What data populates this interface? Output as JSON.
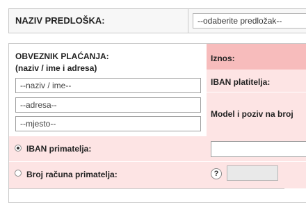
{
  "template": {
    "label": "NAZIV PREDLOŠKA:",
    "select_value": "--odaberite predložak--"
  },
  "payer": {
    "heading": "OBVEZNIK PLAĆANJA:",
    "subheading": "(naziv / ime i adresa)",
    "name_placeholder": "--naziv / ime--",
    "address_placeholder": "--adresa--",
    "city_placeholder": "--mjesto--"
  },
  "right": {
    "amount_label": "Iznos:",
    "payer_iban_label": "IBAN platitelja:",
    "model_label": "Model i poziv na broj"
  },
  "recipient": {
    "iban_option_label": "IBAN primatelja:",
    "account_option_label": "Broj računa primatelja:",
    "help_symbol": "?",
    "selected_option": "iban"
  },
  "colors": {
    "pink_light": "#fde4e4",
    "pink_dark": "#f7bcbc",
    "border": "#c9c9c9"
  }
}
